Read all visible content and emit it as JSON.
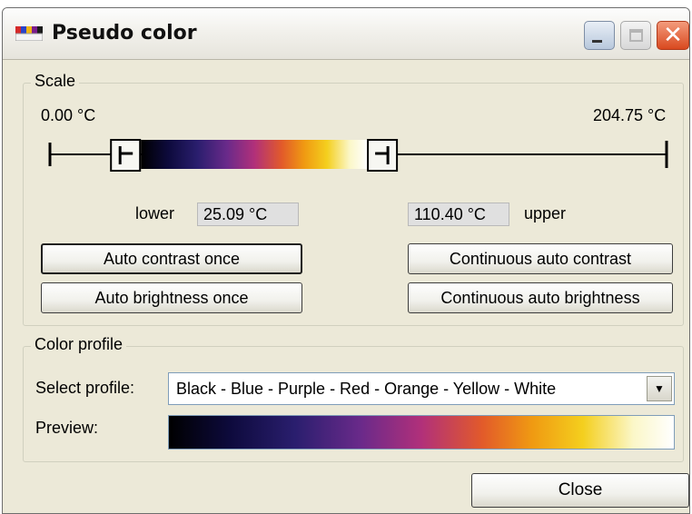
{
  "window": {
    "title": "Pseudo color",
    "controls": {
      "minimize_icon": "minimize-icon",
      "maximize_icon": "maximize-icon",
      "close_icon": "close-icon",
      "close_glyph": "✕"
    }
  },
  "scale": {
    "group_label": "Scale",
    "min_label": "0.00 °C",
    "max_label": "204.75 °C",
    "lower_label": "lower",
    "lower_value": "25.09 °C",
    "upper_value": "110.40 °C",
    "upper_label": "upper",
    "range_min": 0.0,
    "range_max": 204.75,
    "lower_temp": 25.09,
    "upper_temp": 110.4
  },
  "buttons": {
    "auto_contrast_once": "Auto contrast once",
    "auto_brightness_once": "Auto brightness once",
    "continuous_auto_contrast": "Continuous auto contrast",
    "continuous_auto_brightness": "Continuous auto brightness",
    "close": "Close"
  },
  "color_profile": {
    "group_label": "Color profile",
    "select_label": "Select profile:",
    "selected_profile": "Black - Blue - Purple - Red - Orange - Yellow - White",
    "preview_label": "Preview:",
    "dropdown_glyph": "▼"
  },
  "colors": {
    "gradient": [
      "#000000",
      "#0d0a3c",
      "#2a1e6e",
      "#6a2a8a",
      "#b1307a",
      "#e25a2a",
      "#f09a12",
      "#f4cf1e",
      "#fbf7c8",
      "#ffffff"
    ],
    "close_button": "#d9491f"
  }
}
